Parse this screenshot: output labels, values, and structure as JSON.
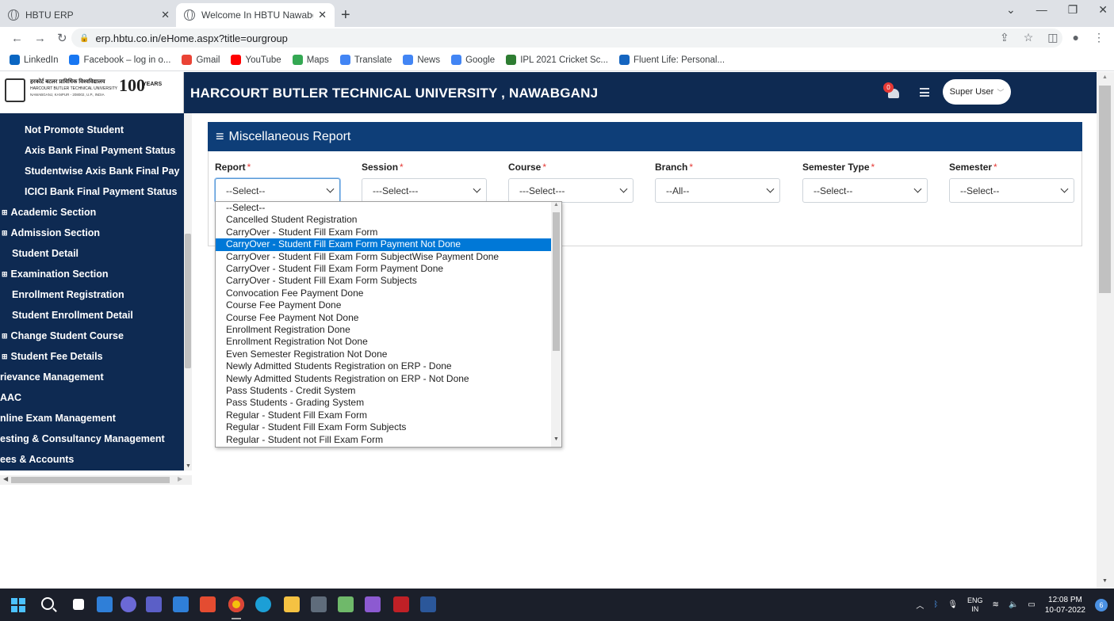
{
  "browser": {
    "tabs": [
      {
        "title": "HBTU ERP",
        "active": false
      },
      {
        "title": "Welcome In HBTU Nawabganj Ca",
        "active": true
      }
    ],
    "url": "erp.hbtu.co.in/eHome.aspx?title=ourgroup",
    "bookmarks": [
      {
        "label": "LinkedIn",
        "icon": "linkedin-icon",
        "color": "#0a66c2"
      },
      {
        "label": "Facebook – log in o...",
        "icon": "facebook-icon",
        "color": "#1877f2"
      },
      {
        "label": "Gmail",
        "icon": "gmail-icon",
        "color": "#ea4335"
      },
      {
        "label": "YouTube",
        "icon": "youtube-icon",
        "color": "#ff0000"
      },
      {
        "label": "Maps",
        "icon": "maps-icon",
        "color": "#34a853"
      },
      {
        "label": "Translate",
        "icon": "translate-icon",
        "color": "#4285f4"
      },
      {
        "label": "News",
        "icon": "news-icon",
        "color": "#4285f4"
      },
      {
        "label": "Google",
        "icon": "google-icon",
        "color": "#4285f4"
      },
      {
        "label": "IPL 2021 Cricket Sc...",
        "icon": "cricket-icon",
        "color": "#2e7d32"
      },
      {
        "label": "Fluent Life: Personal...",
        "icon": "flag-icon",
        "color": "#1565c0"
      }
    ]
  },
  "header": {
    "logo_line1": "हरकोर्ट बटलर प्राविधिक विश्वविद्यालय",
    "logo_line2": "HARCOURT BUTLER TECHNICAL UNIVERSITY",
    "logo_line3": "NAWABGANJ, KANPUR - 208002, U.P., INDIA",
    "logo_100": "100",
    "logo_years": "YEARS",
    "title": "HARCOURT BUTLER TECHNICAL UNIVERSITY , NAWABGANJ",
    "notification_count": "0",
    "user_label": "Super User"
  },
  "sidebar": {
    "items": [
      {
        "label": "Not Promote Student",
        "type": "sub"
      },
      {
        "label": "Axis Bank Final Payment Status",
        "type": "sub"
      },
      {
        "label": "Studentwise Axis Bank Final Pay",
        "type": "sub"
      },
      {
        "label": "ICICI Bank Final Payment Status",
        "type": "sub"
      },
      {
        "label": "Academic Section",
        "type": "plus"
      },
      {
        "label": "Admission Section",
        "type": "plus"
      },
      {
        "label": "Student Detail",
        "type": "top"
      },
      {
        "label": "Examination Section",
        "type": "plus"
      },
      {
        "label": "Enrollment Registration",
        "type": "top"
      },
      {
        "label": "Student Enrollment Detail",
        "type": "top"
      },
      {
        "label": "Change Student Course",
        "type": "plus"
      },
      {
        "label": "Student Fee Details",
        "type": "plus"
      },
      {
        "label": "rievance Management",
        "type": "cut"
      },
      {
        "label": "AAC",
        "type": "cut"
      },
      {
        "label": "nline Exam Management",
        "type": "cut"
      },
      {
        "label": "esting & Consultancy Management",
        "type": "cut"
      },
      {
        "label": "ees & Accounts",
        "type": "cut"
      }
    ],
    "plus_glyph": "⊞"
  },
  "report": {
    "title": "Miscellaneous Report",
    "fields": [
      {
        "label": "Report",
        "value": "--Select--"
      },
      {
        "label": "Session",
        "value": "---Select---"
      },
      {
        "label": "Course",
        "value": "---Select---"
      },
      {
        "label": "Branch",
        "value": "--All--"
      },
      {
        "label": "Semester Type",
        "value": "--Select--"
      },
      {
        "label": "Semester",
        "value": "--Select--"
      }
    ],
    "required_mark": "*"
  },
  "dropdown": {
    "selected_index": 3,
    "options": [
      "--Select--",
      "Cancelled Student Registration",
      "CarryOver - Student Fill Exam Form",
      "CarryOver - Student Fill Exam Form Payment Not Done",
      "CarryOver - Student Fill Exam Form SubjectWise Payment Done",
      "CarryOver - Student Fill Exam Form Payment Done",
      "CarryOver - Student Fill Exam Form Subjects",
      "Convocation Fee Payment Done",
      "Course Fee Payment Done",
      "Course Fee Payment Not Done",
      "Enrollment Registration Done",
      "Enrollment Registration Not Done",
      "Even Semester Registration Not Done",
      "Newly Admitted Students Registration on ERP - Done",
      "Newly Admitted Students Registration on ERP - Not Done",
      "Pass Students - Credit System",
      "Pass Students - Grading System",
      "Regular - Student Fill Exam Form",
      "Regular - Student Fill Exam Form Subjects",
      "Regular - Student not Fill Exam Form"
    ]
  },
  "taskbar": {
    "lang_top": "ENG",
    "lang_bottom": "IN",
    "time": "12:08 PM",
    "date": "10-07-2022",
    "notification_count": "6"
  },
  "colors": {
    "navy": "#0e2a52",
    "card_header": "#0e3e78",
    "selected_option": "#0078d7"
  }
}
